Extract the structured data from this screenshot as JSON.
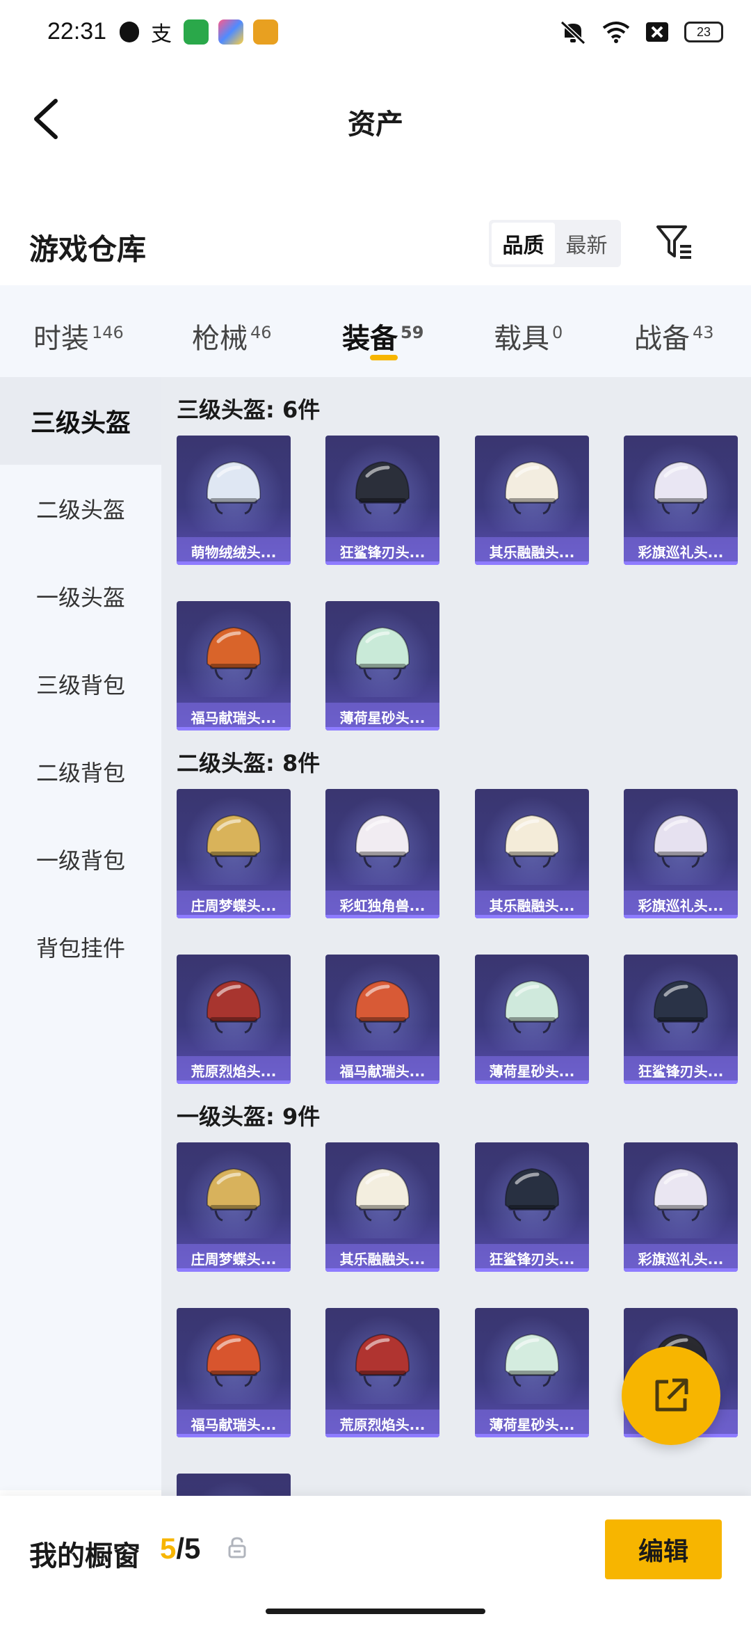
{
  "status_bar": {
    "time": "22:31",
    "left_icons": [
      "shield-app-icon",
      "alipay-icon",
      "oppo-app-icon",
      "app-store-icon",
      "game-app-icon"
    ],
    "right_icons": [
      "mute-icon",
      "wifi-icon",
      "close-box-icon"
    ],
    "battery": "23"
  },
  "header": {
    "title": "资产",
    "back_icon": "back-chevron-icon"
  },
  "warehouse": {
    "title": "游戏仓库",
    "sort_options": [
      "品质",
      "最新"
    ],
    "sort_selected": "品质",
    "filter_icon": "filter-icon"
  },
  "tabs": [
    {
      "label": "时装",
      "count": "146"
    },
    {
      "label": "枪械",
      "count": "46"
    },
    {
      "label": "装备",
      "count": "59",
      "active": true
    },
    {
      "label": "载具",
      "count": "0"
    },
    {
      "label": "战备",
      "count": "43"
    }
  ],
  "sidebar": {
    "items": [
      "三级头盔",
      "二级头盔",
      "一级头盔",
      "三级背包",
      "二级背包",
      "一级背包",
      "背包挂件"
    ],
    "active": "三级头盔"
  },
  "sections": [
    {
      "title": "三级头盔: 6件",
      "items": [
        {
          "label": "萌物绒绒头...",
          "color": "#dfe7f3"
        },
        {
          "label": "狂鲨锋刃头...",
          "color": "#2b2f3a"
        },
        {
          "label": "其乐融融头...",
          "color": "#f3ede0"
        },
        {
          "label": "彩旗巡礼头...",
          "color": "#e9e6f3"
        },
        {
          "label": "福马献瑞头...",
          "color": "#d9642a"
        },
        {
          "label": "薄荷星砂头...",
          "color": "#c9ead8"
        }
      ]
    },
    {
      "title": "二级头盔: 8件",
      "items": [
        {
          "label": "庄周梦蝶头...",
          "color": "#d9b35a"
        },
        {
          "label": "彩虹独角兽...",
          "color": "#f1ecf2"
        },
        {
          "label": "其乐融融头...",
          "color": "#f4ecd9"
        },
        {
          "label": "彩旗巡礼头...",
          "color": "#e6e1f0"
        },
        {
          "label": "荒原烈焰头...",
          "color": "#a8352f"
        },
        {
          "label": "福马献瑞头...",
          "color": "#d85a36"
        },
        {
          "label": "薄荷星砂头...",
          "color": "#cfe9dc"
        },
        {
          "label": "狂鲨锋刃头...",
          "color": "#2a3347"
        }
      ]
    },
    {
      "title": "一级头盔: 9件",
      "items": [
        {
          "label": "庄周梦蝶头...",
          "color": "#d8b25c"
        },
        {
          "label": "其乐融融头...",
          "color": "#f3eedf"
        },
        {
          "label": "狂鲨锋刃头...",
          "color": "#283041"
        },
        {
          "label": "彩旗巡礼头...",
          "color": "#eae6f2"
        },
        {
          "label": "福马献瑞头...",
          "color": "#d8552e"
        },
        {
          "label": "荒原烈焰头...",
          "color": "#b03430"
        },
        {
          "label": "薄荷星砂头...",
          "color": "#d4ecdf"
        },
        {
          "label": "",
          "color": "#2a2a30"
        },
        {
          "label": "",
          "color": "#3c3a7e"
        }
      ]
    }
  ],
  "showcase": {
    "title": "我的橱窗",
    "count_current": "5",
    "count_sep": "/5",
    "edit_label": "编辑"
  },
  "colors": {
    "accent": "#f7b500",
    "card_bg": "#3c3a7e",
    "tab_bg": "#f4f7fc"
  }
}
